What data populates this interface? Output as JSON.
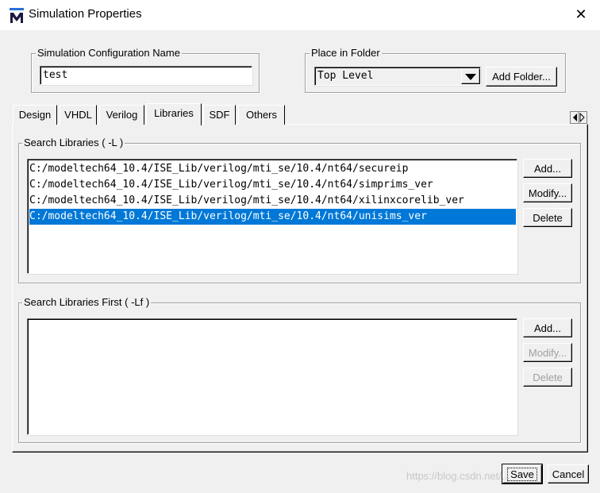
{
  "window": {
    "title": "Simulation Properties",
    "close_label": "✕",
    "logo_letter": "M"
  },
  "config_name": {
    "legend": "Simulation Configuration Name",
    "value": "test"
  },
  "folder": {
    "legend": "Place in Folder",
    "selected": "Top Level",
    "add_folder_label": "Add Folder..."
  },
  "tabs": [
    {
      "label": "Design"
    },
    {
      "label": "VHDL"
    },
    {
      "label": "Verilog"
    },
    {
      "label": "Libraries",
      "active": true
    },
    {
      "label": "SDF"
    },
    {
      "label": "Others"
    }
  ],
  "search_libraries": {
    "legend": "Search Libraries ( -L )",
    "items": [
      "C:/modeltech64_10.4/ISE_Lib/verilog/mti_se/10.4/nt64/secureip",
      "C:/modeltech64_10.4/ISE_Lib/verilog/mti_se/10.4/nt64/simprims_ver",
      "C:/modeltech64_10.4/ISE_Lib/verilog/mti_se/10.4/nt64/xilinxcorelib_ver",
      "C:/modeltech64_10.4/ISE_Lib/verilog/mti_se/10.4/nt64/unisims_ver"
    ],
    "selected_index": 3,
    "add_label": "Add...",
    "modify_label": "Modify...",
    "delete_label": "Delete"
  },
  "search_libraries_first": {
    "legend": "Search Libraries First ( -Lf )",
    "add_label": "Add...",
    "modify_label": "Modify...",
    "delete_label": "Delete"
  },
  "footer": {
    "save_label": "Save",
    "cancel_label": "Cancel",
    "watermark": "https://blog.csdn.net/..."
  }
}
